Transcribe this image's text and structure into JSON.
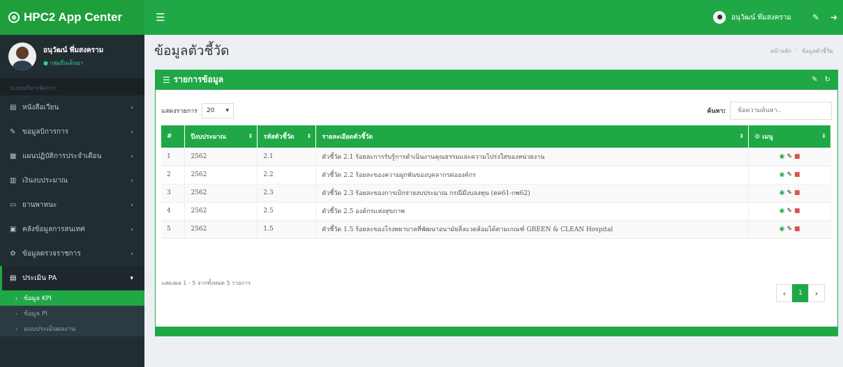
{
  "app": {
    "title": "HPC2 App Center"
  },
  "navbar": {
    "toggle_icon": "☰",
    "user_name": "อนุวัฒน์ พึ่มสงคราม"
  },
  "sidebar": {
    "user_name": "อนุวัฒน์ พึ่มสงคราม",
    "user_status": "● กลุ่มยืนเด็นยา",
    "header": "ระบบบริหารจัดการ",
    "items": [
      {
        "icon": "▤",
        "label": "หนังสือเวียน"
      },
      {
        "icon": "✎",
        "label": "ขอมูลบิการการ"
      },
      {
        "icon": "▦",
        "label": "แผนปฏิบัติการประจำเดือน"
      },
      {
        "icon": "▥",
        "label": "เงินงบประมาณ"
      },
      {
        "icon": "▭",
        "label": "ยานพาหนะ"
      },
      {
        "icon": "▣",
        "label": "คลังข้อมูลการสนเทศ"
      },
      {
        "icon": "⚙",
        "label": "ข้อมูลตรวจราชการ"
      },
      {
        "icon": "▤",
        "label": "ประเมิน PA"
      }
    ],
    "sub_items": [
      {
        "label": "ข้อมูล KPI"
      },
      {
        "label": "ข้อมูล PI"
      },
      {
        "label": "แบบประเมินผลงาน"
      }
    ]
  },
  "page": {
    "title": "ข้อมูลตัวชี้วัด",
    "breadcrumb": [
      "หน้าหลัก",
      "ข้อมูลตัวชี้วัด"
    ]
  },
  "box": {
    "title": "รายการข้อมูล"
  },
  "controls": {
    "length_label": "แสดงรายการ",
    "length_value": "20",
    "search_label": "ค้นหา:",
    "search_placeholder": "ข้อความค้นหา.."
  },
  "table": {
    "headers": [
      "#",
      "ปีงบประมาณ",
      "รหัสตัวชี้วัด",
      "รายละเอียดตัวชี้วัด",
      "เมนู"
    ],
    "rows": [
      {
        "no": "1",
        "year": "2562",
        "code": "2.1",
        "detail": "ตัวชี้วัด 2.1 ร้อยละการรับรู้การดำเนินงานคุณธรรมและความโปร่งใสของหน่วยงาน"
      },
      {
        "no": "2",
        "year": "2562",
        "code": "2.2",
        "detail": "ตัวชี้วัด 2.2 ร้อยละของความผูกพันของบุคลากรต่อองค์กร"
      },
      {
        "no": "3",
        "year": "2562",
        "code": "2.3",
        "detail": "ตัวชี้วัด 2.3 ร้อยละของการเบิกจ่ายงบประมาณ กรณีมีงบลงทุน (ตค61-กพ62)"
      },
      {
        "no": "4",
        "year": "2562",
        "code": "2.5",
        "detail": "ตัวชี้วัด 2.5 องค์กรแห่งสุขภาพ"
      },
      {
        "no": "5",
        "year": "2562",
        "code": "1.5",
        "detail": "ตัวชี้วัด 1.5 ร้อยละของโรงพยาบาลที่พัฒนาอนามัยสิ่งแวดล้อมได้ตามเกณฑ์ GREEN & CLEAN Hospital"
      }
    ]
  },
  "info": "แสดงผล 1 - 5 จากทั้งหมด 5 รายการ",
  "pagination": {
    "prev": "‹",
    "current": "1",
    "next": "›"
  }
}
